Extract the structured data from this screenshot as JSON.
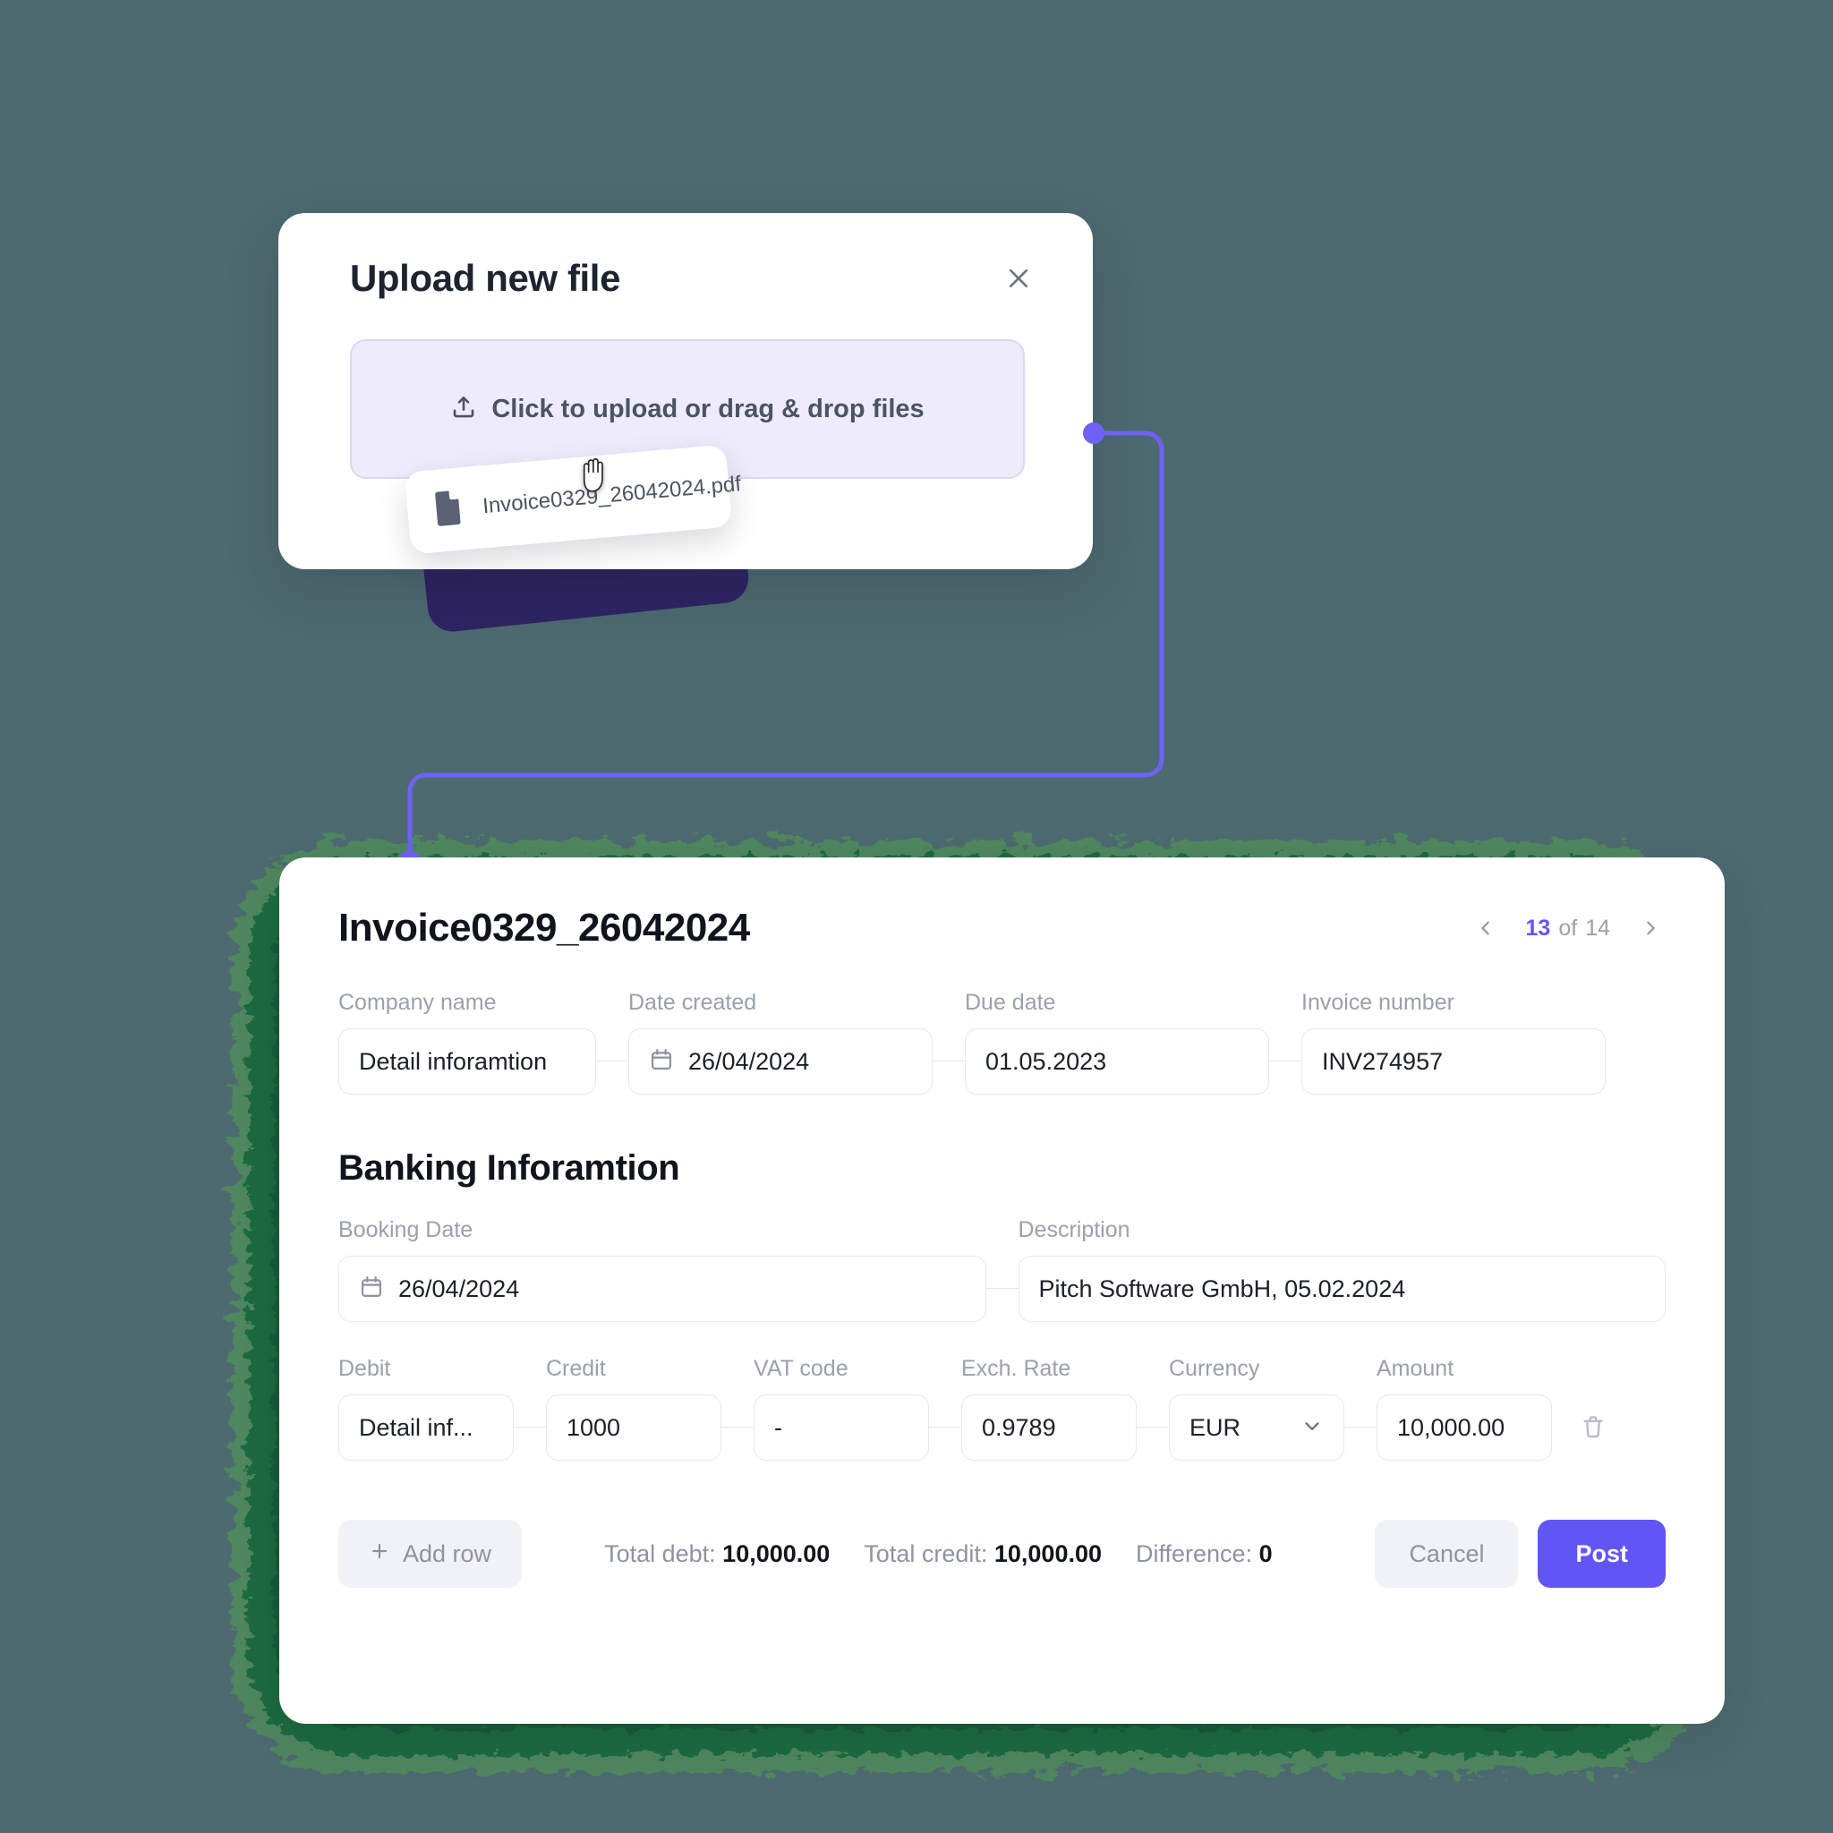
{
  "theme": {
    "background": "#4d6a70",
    "accent": "#6255f5",
    "dropzone_bg": "#eeebfb",
    "brush_green": "#1e6b42",
    "shadow_card": "#2e2463"
  },
  "upload_modal": {
    "title": "Upload new file",
    "close_icon": "close-icon",
    "dropzone": {
      "icon": "upload-icon",
      "label": "Click to upload or drag & drop files"
    },
    "file_chip": {
      "icon": "file-icon",
      "filename": "Invoice0329_26042024.pdf"
    },
    "cursor": "grab-hand-cursor"
  },
  "invoice": {
    "title": "Invoice0329_26042024",
    "pager": {
      "prev_icon": "chevron-left-icon",
      "next_icon": "chevron-right-icon",
      "current": "13",
      "of": "of",
      "total": "14"
    },
    "top_fields": [
      {
        "label": "Company name",
        "value": "Detail inforamtion",
        "icon": null
      },
      {
        "label": "Date created",
        "value": "26/04/2024",
        "icon": "calendar-icon"
      },
      {
        "label": "Due date",
        "value": "01.05.2023",
        "icon": null
      },
      {
        "label": "Invoice number",
        "value": "INV274957",
        "icon": null
      }
    ],
    "section_title": "Banking Inforamtion",
    "bank_fields": [
      {
        "label": "Booking Date",
        "value": "26/04/2024",
        "icon": "calendar-icon"
      },
      {
        "label": "Description",
        "value": "Pitch Software GmbH, 05.02.2024",
        "icon": null
      }
    ],
    "ledger_fields": [
      {
        "label": "Debit",
        "value": "Detail inf...",
        "type": "text"
      },
      {
        "label": "Credit",
        "value": "1000",
        "type": "text"
      },
      {
        "label": "VAT code",
        "value": "-",
        "type": "text"
      },
      {
        "label": "Exch. Rate",
        "value": "0.9789",
        "type": "text"
      },
      {
        "label": "Currency",
        "value": "EUR",
        "type": "select"
      },
      {
        "label": "Amount",
        "value": "10,000.00",
        "type": "text"
      }
    ],
    "delete_row_icon": "trash-icon",
    "footer": {
      "add_row_label": "Add row",
      "add_row_icon": "plus-icon",
      "total_debt_label": "Total debt:",
      "total_debt_value": "10,000.00",
      "total_credit_label": "Total credit:",
      "total_credit_value": "10,000.00",
      "difference_label": "Difference:",
      "difference_value": "0",
      "cancel_label": "Cancel",
      "post_label": "Post"
    }
  }
}
